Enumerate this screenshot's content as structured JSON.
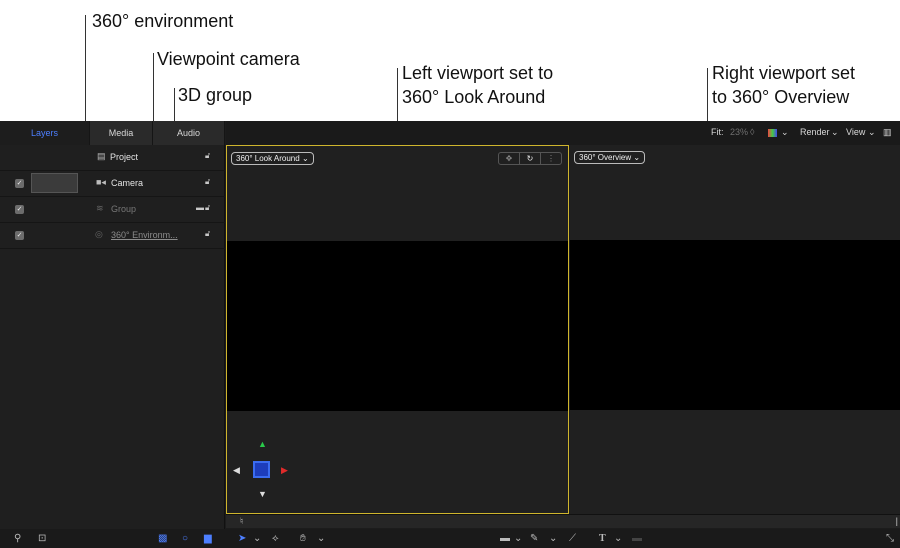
{
  "callouts": {
    "env": "360° environment",
    "camera": "Viewpoint camera",
    "group": "3D group",
    "left_line1": "Left viewport set to",
    "left_line2": "360° Look Around",
    "right_line1": "Right viewport set",
    "right_line2": "to 360° Overview"
  },
  "tabs": [
    "Layers",
    "Media",
    "Audio"
  ],
  "layers": [
    {
      "name": "Project",
      "icon": "page-icon"
    },
    {
      "name": "Camera",
      "icon": "camera-icon"
    },
    {
      "name": "Group",
      "icon": "group-icon"
    },
    {
      "name": "360° Environm...",
      "icon": "sphere-icon"
    }
  ],
  "toolbar": {
    "fit_label": "Fit:",
    "fit_value": "23%",
    "render_label": "Render",
    "view_label": "View"
  },
  "viewports": {
    "left_mode": "360° Look Around",
    "right_mode": "360° Overview"
  },
  "colors": {
    "accent": "#4d7fff",
    "viewport_border": "#cfb52d",
    "gizmo_green": "#29c94a",
    "gizmo_red": "#e02a2a",
    "gizmo_blue": "#3a6cf0"
  }
}
